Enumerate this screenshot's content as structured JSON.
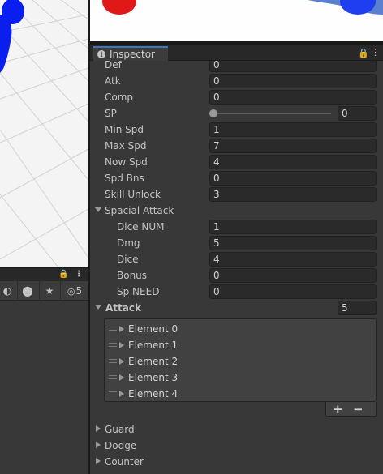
{
  "left_panel": {
    "toolbar_badge": "5"
  },
  "inspector": {
    "tab_title": "Inspector",
    "fields": [
      {
        "label": "Def",
        "value": "0"
      },
      {
        "label": "Atk",
        "value": "0"
      },
      {
        "label": "Comp",
        "value": "0"
      },
      {
        "label": "SP",
        "value": "0",
        "slider_fraction": 0
      },
      {
        "label": "Min Spd",
        "value": "1"
      },
      {
        "label": "Max Spd",
        "value": "7"
      },
      {
        "label": "Now Spd",
        "value": "4"
      },
      {
        "label": "Spd Bns",
        "value": "0"
      },
      {
        "label": "Skill Unlock",
        "value": "3"
      }
    ],
    "spacial_attack": {
      "label": "Spacial Attack",
      "fields": [
        {
          "label": "Dice NUM",
          "value": "1"
        },
        {
          "label": "Dmg",
          "value": "5"
        },
        {
          "label": "Dice",
          "value": "4"
        },
        {
          "label": "Bonus",
          "value": "0"
        },
        {
          "label": "Sp NEED",
          "value": "0"
        }
      ]
    },
    "attack": {
      "label": "Attack",
      "size": "5",
      "elements": [
        "Element 0",
        "Element 1",
        "Element 2",
        "Element 3",
        "Element 4"
      ],
      "add_label": "+",
      "remove_label": "−"
    },
    "collapsed_foldouts": [
      "Guard",
      "Dodge",
      "Counter"
    ]
  },
  "colors": {
    "accent_tab": "#3a79bb",
    "scene_blue": "#0a1ef0",
    "scene_red": "#e01818"
  }
}
